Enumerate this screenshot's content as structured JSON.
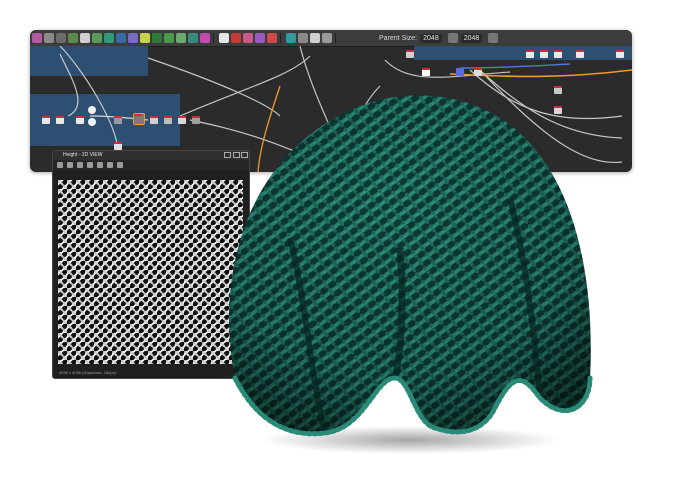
{
  "toolbar": {
    "parent_size_label": "Parent Size:",
    "parent_size_value": "2048",
    "output_size_value": "2048",
    "icons": [
      "graph-icon",
      "layers-icon",
      "nodes-icon",
      "blend-icon",
      "levels-icon",
      "curve-icon",
      "transform-icon",
      "warp-icon",
      "normal-icon",
      "height-icon",
      "color-icon",
      "fx-map-icon",
      "gradient-icon",
      "shape-icon",
      "uniform-color-icon",
      "text-icon",
      "fx-icon",
      "pixel-processor-icon",
      "bitmap-icon",
      "svg-icon",
      "frame-icon",
      "comment-icon",
      "pin-icon",
      "align-icon",
      "link-icon",
      "refresh-icon"
    ]
  },
  "view2d": {
    "title": "Height - 2D VIEW",
    "status": "4096 x 4096 (Grayscale, 16bpc)"
  },
  "colors": {
    "frame_blue": "#2c4f72",
    "graph_bg": "#2b2b2b",
    "node_header": "#c5303a",
    "wire": "#d7d7d7",
    "wire_orange": "#f09a2a",
    "wire_blue": "#4a7bd6",
    "beanie_green": "#1f6b5e",
    "beanie_dark": "#0c3a33"
  }
}
